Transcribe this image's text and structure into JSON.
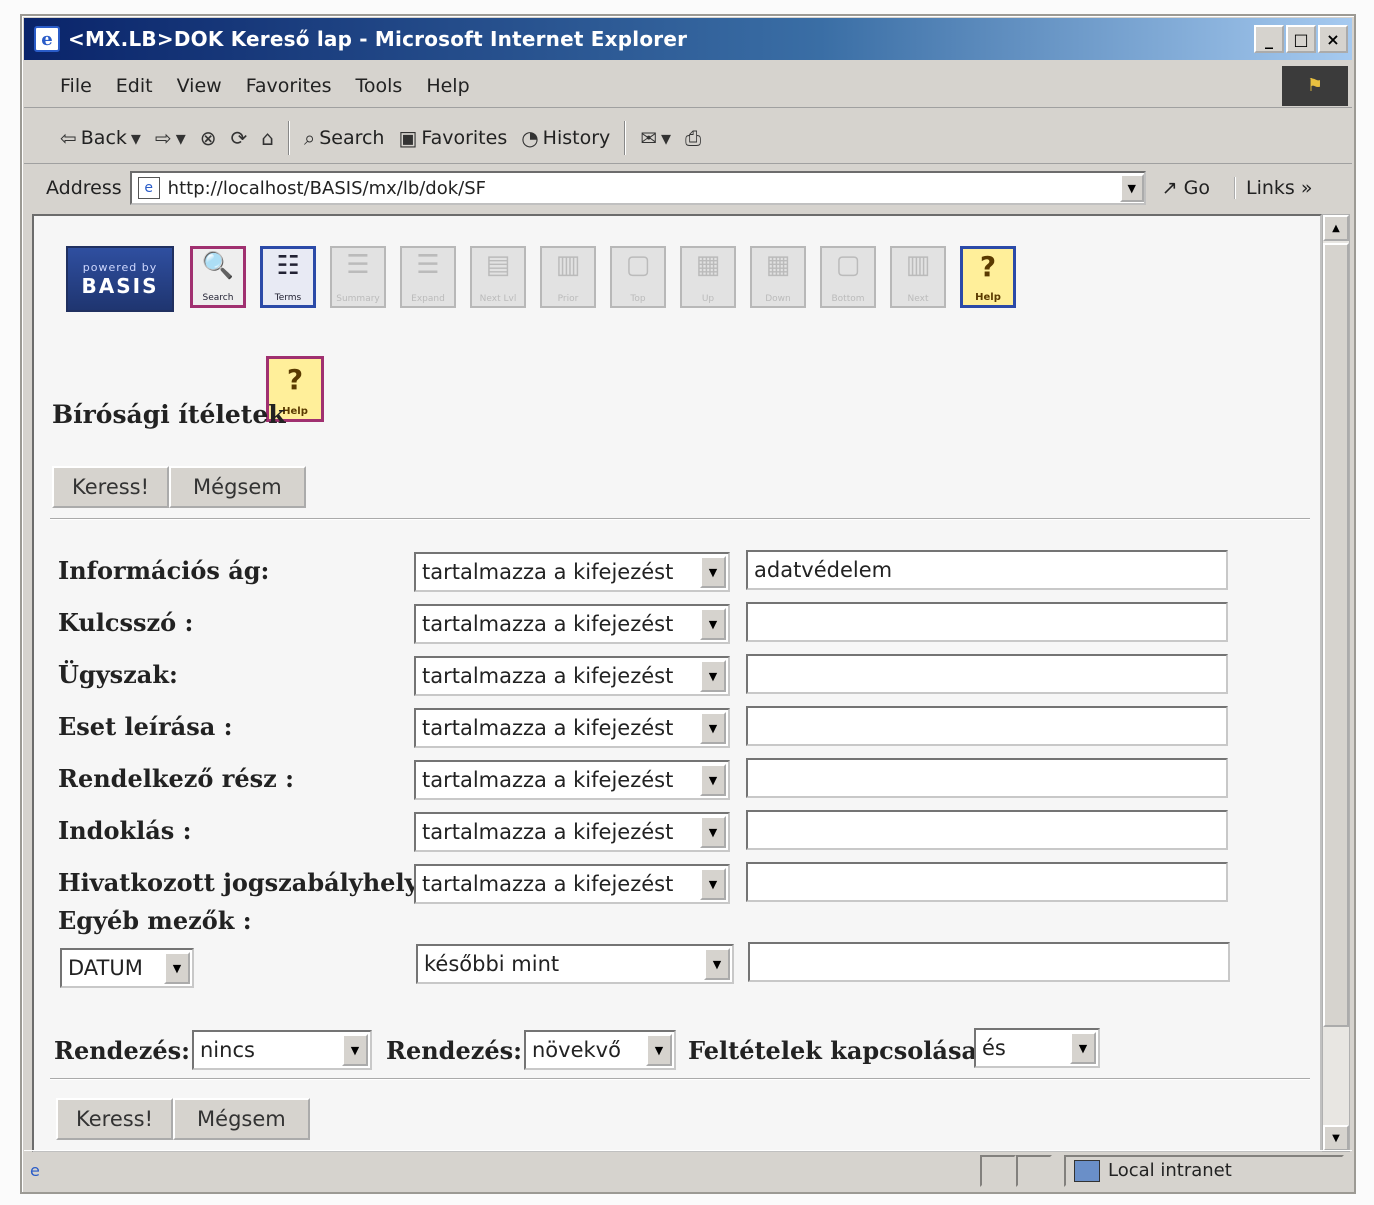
{
  "window": {
    "title": "<MX.LB>DOK Kereső lap - Microsoft Internet Explorer",
    "minimize": "_",
    "maximize": "□",
    "close": "×"
  },
  "menu": [
    "File",
    "Edit",
    "View",
    "Favorites",
    "Tools",
    "Help"
  ],
  "toolbar": {
    "back": "Back",
    "search": "Search",
    "favorites": "Favorites",
    "history": "History"
  },
  "address": {
    "label": "Address",
    "url": "http://localhost/BASIS/mx/lb/dok/SF",
    "go": "Go",
    "links": "Links"
  },
  "page": {
    "logo_small": "powered by",
    "logo_big": "BASIS",
    "tool_icons": [
      {
        "name": "search",
        "label": "Search",
        "glyph": "🔍",
        "state": "active"
      },
      {
        "name": "terms",
        "label": "Terms",
        "glyph": "☷",
        "state": "active"
      },
      {
        "name": "summary",
        "label": "Summary",
        "glyph": "☰",
        "state": "disabled"
      },
      {
        "name": "expand",
        "label": "Expand",
        "glyph": "☰",
        "state": "disabled"
      },
      {
        "name": "next-level",
        "label": "Next Lvl",
        "glyph": "▤",
        "state": "disabled"
      },
      {
        "name": "prior",
        "label": "Prior",
        "glyph": "▥",
        "state": "disabled"
      },
      {
        "name": "top",
        "label": "Top",
        "glyph": "▢",
        "state": "disabled"
      },
      {
        "name": "up",
        "label": "Up",
        "glyph": "▦",
        "state": "disabled"
      },
      {
        "name": "down",
        "label": "Down",
        "glyph": "▦",
        "state": "disabled"
      },
      {
        "name": "bottom",
        "label": "Bottom",
        "glyph": "▢",
        "state": "disabled"
      },
      {
        "name": "next",
        "label": "Next",
        "glyph": "▥",
        "state": "disabled"
      },
      {
        "name": "help",
        "label": "Help",
        "glyph": "?",
        "state": "help"
      }
    ],
    "help_label": "Help",
    "help_glyph": "?",
    "title": "Bírósági ítéletek",
    "search_button": "Keress!",
    "cancel_button": "Mégsem",
    "fields": [
      {
        "label": "Információs ág:",
        "operator": "tartalmazza a kifejezést",
        "value": "adatvédelem"
      },
      {
        "label": "Kulcsszó :",
        "operator": "tartalmazza a kifejezést",
        "value": ""
      },
      {
        "label": "Ügyszak:",
        "operator": "tartalmazza a kifejezést",
        "value": ""
      },
      {
        "label": "Eset leírása :",
        "operator": "tartalmazza a kifejezést",
        "value": ""
      },
      {
        "label": "Rendelkező rész :",
        "operator": "tartalmazza a kifejezést",
        "value": ""
      },
      {
        "label": "Indoklás :",
        "operator": "tartalmazza a kifejezést",
        "value": ""
      },
      {
        "label": "Hivatkozott jogszabályhely :",
        "operator": "tartalmazza a kifejezést",
        "value": ""
      }
    ],
    "other_fields_label": "Egyéb mezők :",
    "other_field": {
      "field": "DATUM",
      "operator": "későbbi mint",
      "value": ""
    },
    "sort1_label": "Rendezés:",
    "sort1_value": "nincs",
    "sort2_label": "Rendezés:",
    "sort2_value": "növekvő",
    "connect_label": "Feltételek kapcsolása:",
    "connect_value": "és"
  },
  "status": {
    "zone": "Local intranet"
  }
}
